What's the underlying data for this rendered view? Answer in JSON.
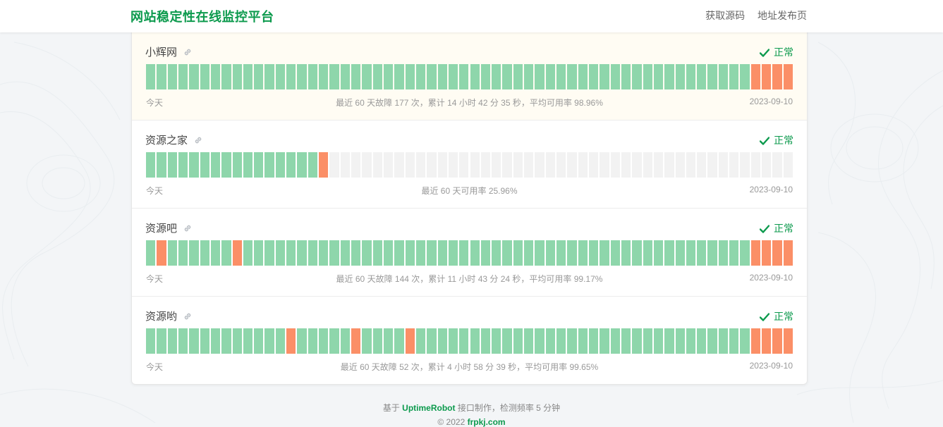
{
  "header": {
    "brand": "网站稳定性在线监控平台",
    "nav": [
      "获取源码",
      "地址发布页"
    ]
  },
  "colors": {
    "up": "#8ed6ab",
    "down": "#fb8f67",
    "none": "#f2f2f2",
    "brand": "#0c9a4d"
  },
  "monitors": [
    {
      "name": "小辉网",
      "status": "正常",
      "left": "今天",
      "summary": "最近 60 天故障 177 次，累计 14 小时 42 分 35 秒，平均可用率 98.96%",
      "date": "2023-09-10",
      "days": "uuuuuuuuuuuuuuuuuuuuuuuuuuuuuuuuuuuuuuuuuuuuuuuuuuuuuuuudddd"
    },
    {
      "name": "资源之家",
      "status": "正常",
      "left": "今天",
      "summary": "最近 60 天可用率 25.96%",
      "date": "2023-09-10",
      "days": "uuuuuuuuuuuuuuuudnnnnnnnnnnnnnnnnnnnnnnnnnnnnnnnnnnnnnnnnnnn"
    },
    {
      "name": "资源吧",
      "status": "正常",
      "left": "今天",
      "summary": "最近 60 天故障 144 次，累计 11 小时 43 分 24 秒，平均可用率 99.17%",
      "date": "2023-09-10",
      "days": "uduuuuuuduuuuuuuuuuuuuuuuuuuuuuuuuuuuuuuuuuuuuuuuuuuuuuudddd"
    },
    {
      "name": "资源哟",
      "status": "正常",
      "left": "今天",
      "summary": "最近 60 天故障 52 次，累计 4 小时 58 分 39 秒，平均可用率 99.65%",
      "date": "2023-09-10",
      "days": "uuuuuuuuuuuuuduuuuuduuuuduuuuuuuuuuuuuuuuuuuuuuuuuuuuuuudddd"
    }
  ],
  "footer": {
    "line1_pre": "基于 ",
    "line1_brand": "UptimeRobot",
    "line1_post": " 接口制作，检测频率 5 分钟",
    "line2_pre": "© 2022 ",
    "line2_brand": "frpkj.com"
  }
}
